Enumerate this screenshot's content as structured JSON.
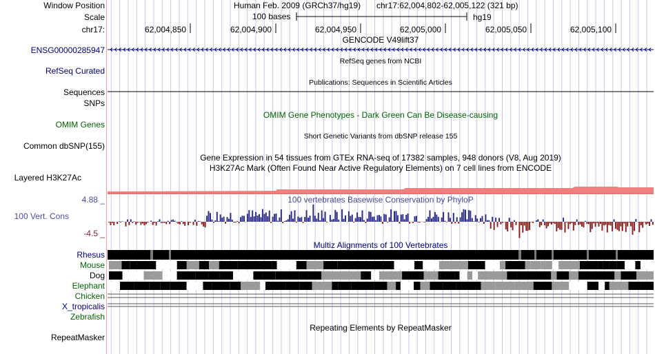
{
  "header": {
    "window_position_label": "Window Position",
    "assembly": "Human Feb. 2009 (GRCh37/hg19)",
    "position": "chr17:62,004,802-62,005,122 (321 bp)",
    "scale_label": "Scale",
    "scale_text": "100 bases",
    "scale_db": "hg19",
    "chrom_label": "chr17:",
    "ruler_ticks": [
      "62,004,850",
      "62,004,900",
      "62,004,950",
      "62,005,000",
      "62,005,050",
      "62,005,100"
    ]
  },
  "tracks": {
    "gencode": {
      "title": "GENCODE V49lift37",
      "gene": "ENSG00000285947"
    },
    "refseq": {
      "label": "RefSeq Curated",
      "title": "RefSeq genes from NCBI"
    },
    "sequences": {
      "label": "Sequences",
      "title": "Publications: Sequences in Scientific Articles"
    },
    "snps": {
      "label": "SNPs"
    },
    "omim": {
      "label": "OMIM Genes",
      "title": "OMIM Gene Phenotypes - Dark Green Can Be Disease-causing"
    },
    "dbsnp": {
      "label": "Common dbSNP(155)",
      "title": "Short Genetic Variants from dbSNP release 155"
    },
    "gtex": {
      "title": "Gene Expression in 54 tissues from GTEx RNA-seq of 17382 samples, 948 donors (V8, Aug 2019)"
    },
    "h3k27ac": {
      "label": "Layered H3K27Ac",
      "title": "H3K27Ac Mark (Often Found Near Active Regulatory Elements) on 7 cell lines from ENCODE"
    },
    "conservation": {
      "label": "100 Vert. Cons",
      "title": "100 vertebrates Basewise Conservation by PhyloP",
      "max_label": "4.88 _",
      "min_label": "-4.5 _"
    },
    "multiz": {
      "title": "Multiz Alignments of 100 Vertebrates",
      "species": [
        "Rhesus",
        "Mouse",
        "Dog",
        "Elephant",
        "Chicken",
        "X_tropicalis",
        "Zebrafish"
      ]
    },
    "repeatmasker": {
      "label": "RepeatMasker",
      "title": "Repeating Elements by RepeatMasker"
    }
  },
  "colors": {
    "navy": "#00007d",
    "green": "#006400",
    "cons_pos": "#2d2d8a",
    "cons_neg": "#8a2222",
    "h3k27ac": "#f08080",
    "grid": "#c8c8e6",
    "divider": "#f4a3a3"
  }
}
